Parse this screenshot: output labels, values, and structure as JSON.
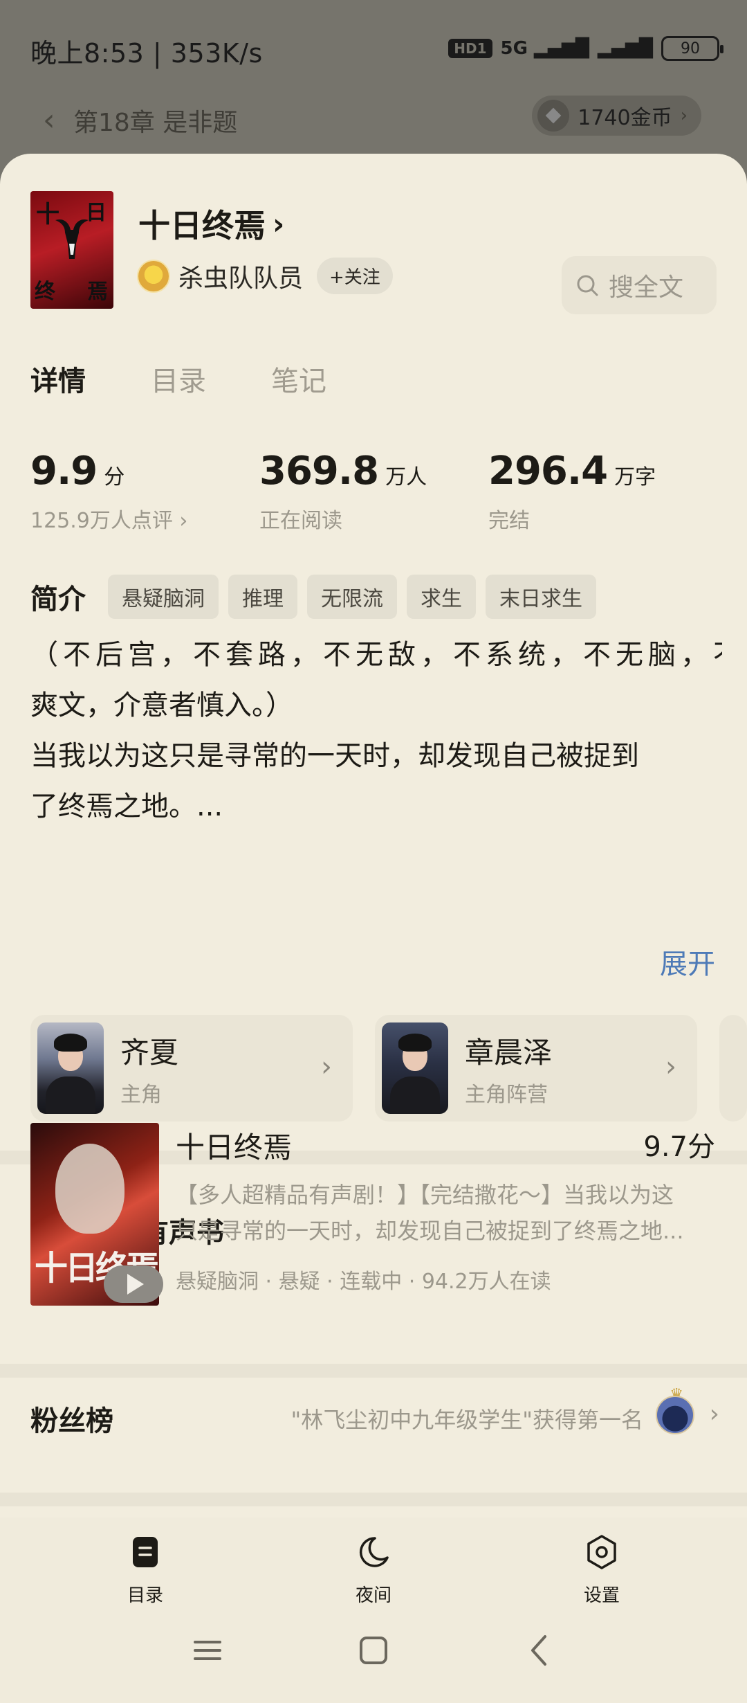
{
  "status_bar": {
    "time": "晚上8:53 | 353K/s",
    "hd_badge": "HD1",
    "signal": "5G",
    "battery": "90"
  },
  "reader_header": {
    "chapter_title": "第18章 是非题",
    "coins": "1740金币"
  },
  "book": {
    "title": "十日终焉",
    "cover_text": [
      "十",
      "日",
      "终",
      "焉"
    ],
    "author": "杀虫队队员",
    "follow_label": "+关注",
    "search_placeholder": "搜全文"
  },
  "tabs": [
    {
      "label": "详情",
      "active": true
    },
    {
      "label": "目录",
      "active": false
    },
    {
      "label": "笔记",
      "active": false
    }
  ],
  "stats": [
    {
      "value": "9.9",
      "unit": "分",
      "sub": "125.9万人点评 ›"
    },
    {
      "value": "369.8",
      "unit": "万人",
      "sub": "正在阅读"
    },
    {
      "value": "296.4",
      "unit": "万字",
      "sub": "完结"
    }
  ],
  "intro": {
    "label": "简介",
    "tags": [
      "悬疑脑洞",
      "推理",
      "无限流",
      "求生",
      "末日求生"
    ],
    "lines": [
      "（不后宫，不套路，不无敌，不系统，不无脑，不",
      "爽文，介意者慎入。）",
      "当我以为这只是寻常的一天时，却发现自己被捉到",
      "了终焉之地。..."
    ],
    "expand_label": "展开"
  },
  "characters": [
    {
      "name": "齐夏",
      "role": "主角"
    },
    {
      "name": "章晨泽",
      "role": "主角阵营"
    }
  ],
  "audio_section": {
    "title": "小说同款有声书",
    "book_title": "十日终焉",
    "cover_title": "十日终焉",
    "score": "9.7分",
    "desc_lines": [
      "【多人超精品有声剧！】【完结撒花～】当我以为这",
      "只是寻常的一天时，却发现自己被捉到了终焉之地..."
    ],
    "meta": "悬疑脑洞 · 悬疑 · 连载中 · 94.2万人在读"
  },
  "fans": {
    "title": "粉丝榜",
    "text": "\"林飞尘初中九年级学生\"获得第一名"
  },
  "bottom_bar": [
    {
      "label": "目录",
      "icon": "catalog-icon"
    },
    {
      "label": "夜间",
      "icon": "moon-icon"
    },
    {
      "label": "设置",
      "icon": "settings-icon"
    }
  ]
}
